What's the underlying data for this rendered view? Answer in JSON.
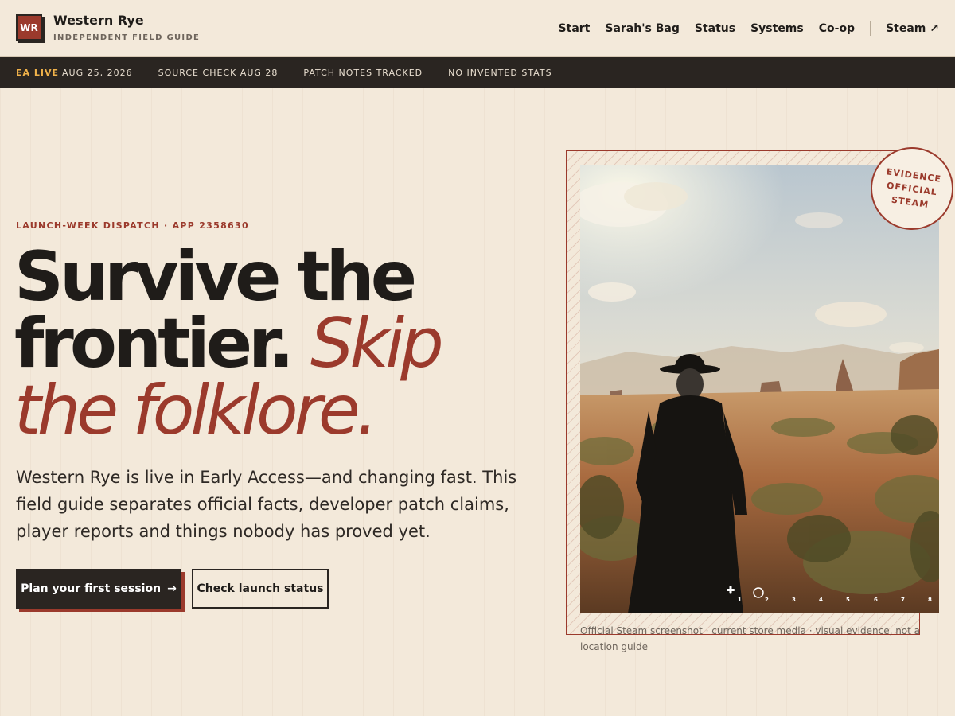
{
  "header": {
    "logo_text": "WR",
    "brand_name": "Western Rye",
    "brand_tagline": "INDEPENDENT FIELD GUIDE",
    "nav": [
      {
        "label": "Start"
      },
      {
        "label": "Sarah's Bag"
      },
      {
        "label": "Status"
      },
      {
        "label": "Systems"
      },
      {
        "label": "Co-op"
      },
      {
        "label": "Steam ↗"
      }
    ]
  },
  "ticker": {
    "live_label": "EA LIVE",
    "live_date": "AUG 25, 2026",
    "items": [
      "SOURCE CHECK AUG 28",
      "PATCH NOTES TRACKED",
      "NO INVENTED STATS"
    ]
  },
  "hero": {
    "kicker": "LAUNCH-WEEK DISPATCH · APP 2358630",
    "headline_main": "Survive the frontier.",
    "headline_accent": "Skip the folklore.",
    "lede": "Western Rye is live in Early Access—and changing fast. This field guide separates official facts, developer patch claims, player reports and things nobody has proved yet.",
    "primary_button": "Plan your first session",
    "primary_button_arrow": "→",
    "secondary_button": "Check launch status"
  },
  "figure": {
    "stamp_lines": [
      "EVIDENCE",
      "OFFICIAL",
      "STEAM"
    ],
    "hotbar_slots": [
      "1",
      "2",
      "3",
      "4",
      "5",
      "6",
      "7",
      "8"
    ],
    "caption": "Official Steam screenshot · current store media · visual evidence, not a location guide"
  },
  "colors": {
    "accent": "#9b3a2c",
    "ink": "#1f1c19",
    "paper": "#f3e9da",
    "highlight": "#f0b24a"
  }
}
